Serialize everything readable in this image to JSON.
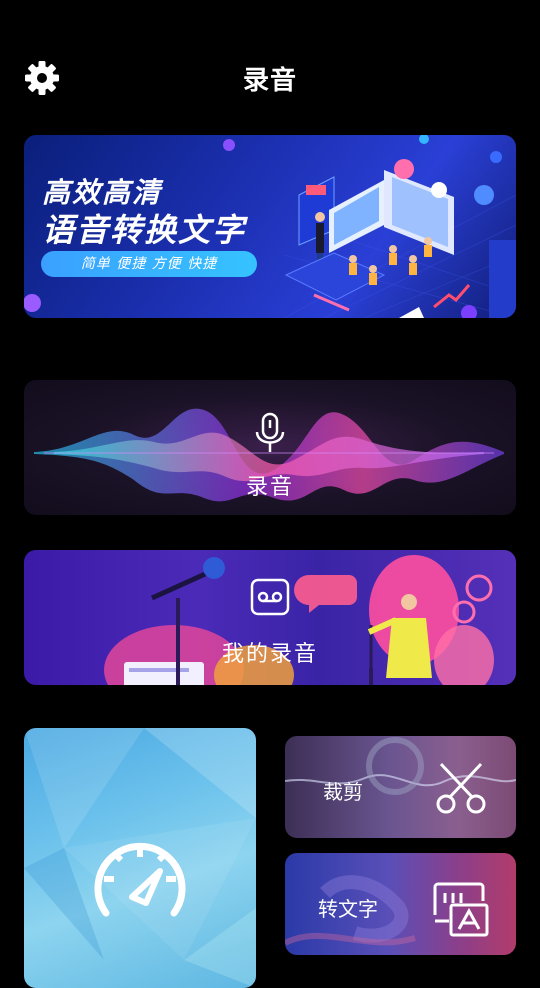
{
  "header": {
    "title": "录音",
    "settings_icon": "gear-icon"
  },
  "banner": {
    "line1": "高效高清",
    "line2": "语音转换文字",
    "tagline": "简单 便捷 方便 快捷"
  },
  "record_card": {
    "label": "录音",
    "icon": "microphone-icon"
  },
  "my_recordings_card": {
    "label": "我的录音",
    "icon": "cassette-icon"
  },
  "speed_card": {
    "icon": "speedometer-icon"
  },
  "cut_card": {
    "label": "裁剪",
    "icon": "scissors-icon"
  },
  "to_text_card": {
    "label": "转文字",
    "icon": "text-recognition-icon"
  },
  "colors": {
    "background": "#000000",
    "accent_blue": "#35b4ff"
  }
}
